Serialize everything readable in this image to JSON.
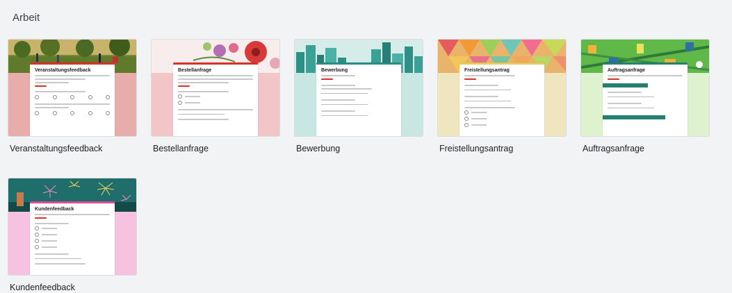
{
  "section": {
    "title": "Arbeit"
  },
  "templates": [
    {
      "name": "Veranstaltungsfeedback",
      "form_title": "Veranstaltungsfeedback",
      "icon": "park-photo-header",
      "accent": "#d9302a",
      "bg": "#e8adab"
    },
    {
      "name": "Bestellanfrage",
      "form_title": "Bestellanfrage",
      "icon": "flower-pattern-header",
      "accent": "#d9302a",
      "bg": "#f2c6c6"
    },
    {
      "name": "Bewerbung",
      "form_title": "Bewerbung",
      "icon": "city-skyline-header",
      "accent": "#2a8c84",
      "bg": "#c8e6e2"
    },
    {
      "name": "Freistellungsantrag",
      "form_title": "Freistellungsantrag",
      "icon": "colorful-diamonds-header",
      "accent": "#e8c95a",
      "bg": "#efe6c0"
    },
    {
      "name": "Auftragsanfrage",
      "form_title": "Auftragsanfrage",
      "icon": "green-city-header",
      "accent": "#26806f",
      "bg": "#dff2cf"
    },
    {
      "name": "Kundenfeedback",
      "form_title": "Kundenfeedback",
      "icon": "fireworks-header",
      "accent": "#e04a9c",
      "bg": "#f7c1e0"
    }
  ]
}
